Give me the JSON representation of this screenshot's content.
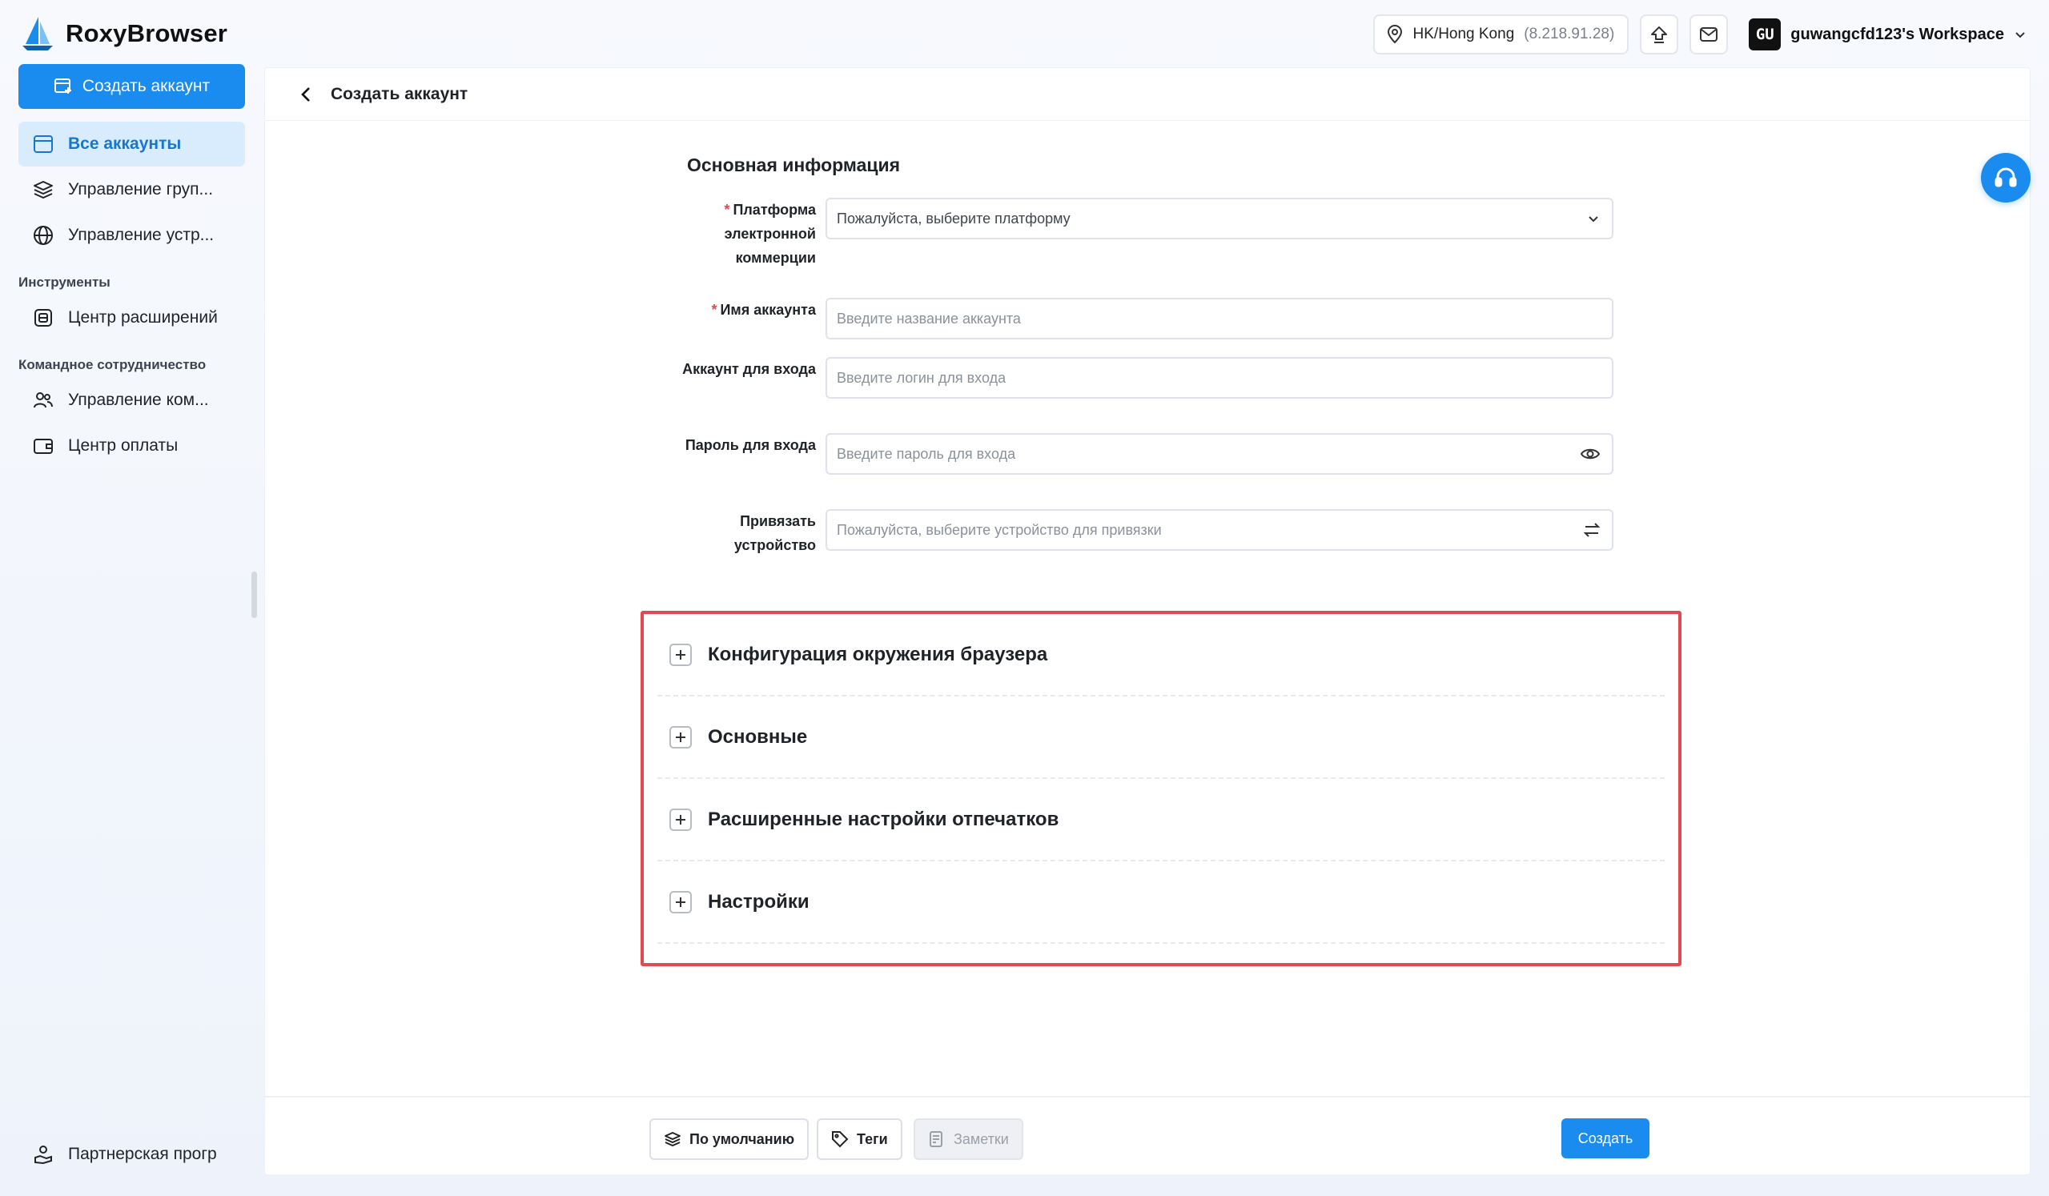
{
  "app": {
    "name": "RoxyBrowser"
  },
  "topbar": {
    "location": "HK/Hong Kong",
    "ip": "(8.218.91.28)",
    "workspace_avatar": "GU",
    "workspace_name": "guwangcfd123's Workspace"
  },
  "sidebar": {
    "create_button": "Создать аккаунт",
    "items": [
      {
        "label": "Все аккаунты",
        "icon": "browser-window-icon",
        "active": true
      },
      {
        "label": "Управление груп...",
        "icon": "layers-icon"
      },
      {
        "label": "Управление устр...",
        "icon": "globe-icon"
      }
    ],
    "section_tools": "Инструменты",
    "tools": [
      {
        "label": "Центр расширений",
        "icon": "extension-icon"
      }
    ],
    "section_team": "Командное сотрудничество",
    "team": [
      {
        "label": "Управление ком...",
        "icon": "users-icon"
      },
      {
        "label": "Центр оплаты",
        "icon": "wallet-icon"
      }
    ],
    "bottom": {
      "label": "Партнерская прогр",
      "icon": "partner-icon"
    }
  },
  "page": {
    "title": "Создать аккаунт",
    "section_title": "Основная информация"
  },
  "form": {
    "platform": {
      "label": "Платформа электронной коммерции",
      "required": true,
      "placeholder": "Пожалуйста, выберите платформу"
    },
    "account_name": {
      "label": "Имя аккаунта",
      "required": true,
      "placeholder": "Введите название аккаунта"
    },
    "login": {
      "label": "Аккаунт для входа",
      "placeholder": "Введите логин для входа"
    },
    "password": {
      "label": "Пароль для входа",
      "placeholder": "Введите пароль для входа"
    },
    "device": {
      "label": "Привязать устройство",
      "placeholder": "Пожалуйста, выберите устройство для привязки"
    }
  },
  "collapses": [
    "Конфигурация окружения браузера",
    "Основные",
    "Расширенные настройки отпечатков",
    "Настройки"
  ],
  "footer": {
    "default_button": "По умолчанию",
    "tags_button": "Теги",
    "notes_button": "Заметки",
    "create_button": "Создать"
  },
  "colors": {
    "accent": "#1a8cf0",
    "highlight": "#e5484d",
    "active_nav_bg": "#d9ecfd"
  }
}
